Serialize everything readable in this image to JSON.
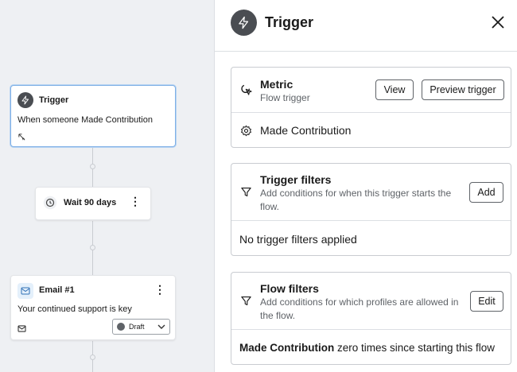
{
  "canvas": {
    "trigger_node": {
      "title": "Trigger",
      "description": "When someone Made Contribution"
    },
    "wait_node": {
      "label": "Wait 90 days",
      "menu_glyph": "⋮"
    },
    "email_node": {
      "title": "Email #1",
      "description": "Your continued support is key",
      "status": "Draft",
      "menu_glyph": "⋮"
    }
  },
  "panel": {
    "title": "Trigger",
    "metric": {
      "title": "Metric",
      "subtitle": "Flow trigger",
      "view_label": "View",
      "preview_label": "Preview trigger",
      "value": "Made Contribution"
    },
    "trigger_filters": {
      "title": "Trigger filters",
      "description": "Add conditions for when this trigger starts the flow.",
      "add_label": "Add",
      "empty_text": "No trigger filters applied"
    },
    "flow_filters": {
      "title": "Flow filters",
      "description": "Add conditions for which profiles are allowed in the flow.",
      "edit_label": "Edit",
      "condition_bold": "Made Contribution",
      "condition_rest": " zero times since starting this flow"
    }
  },
  "icons": {
    "trigger": "lightning-icon",
    "close": "close-icon",
    "metric": "metric-cursor-icon",
    "gear": "gear-icon",
    "filter": "funnel-icon",
    "clock": "clock-icon",
    "mail": "mail-icon"
  }
}
